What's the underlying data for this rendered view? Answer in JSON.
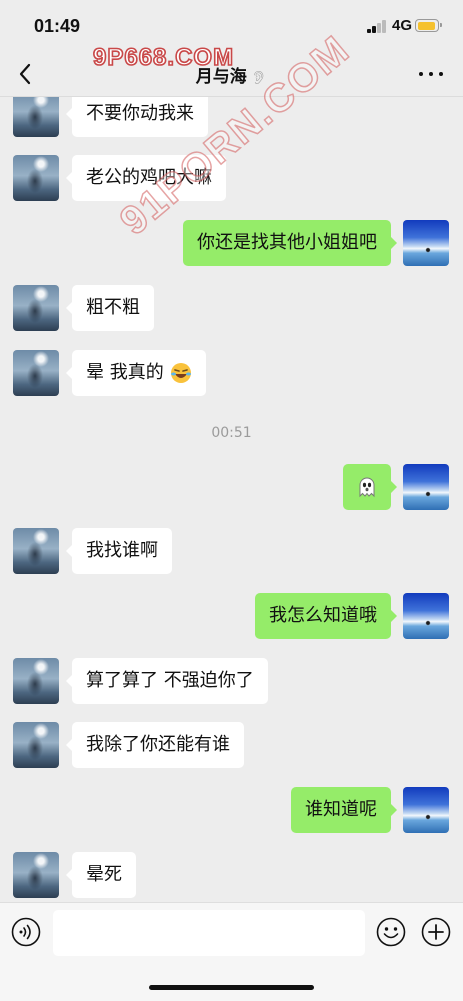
{
  "status_bar": {
    "time": "01:49",
    "network": "4G"
  },
  "header": {
    "title": "月与海"
  },
  "watermarks": {
    "top": "9P668.COM",
    "diagonal": "91PORN.COM"
  },
  "messages": [
    {
      "side": "them",
      "text": "不要你动我来"
    },
    {
      "side": "them",
      "text": "老公的鸡吧大嘛"
    },
    {
      "side": "me",
      "text": "你还是找其他小姐姐吧"
    },
    {
      "side": "them",
      "text": "粗不粗"
    },
    {
      "side": "them",
      "text": "晕 我真的",
      "emoji": "laughing-crying-emoji"
    },
    {
      "side": "time",
      "text": "00:51"
    },
    {
      "side": "me",
      "text": "",
      "emoji": "ghost-emoji"
    },
    {
      "side": "them",
      "text": "我找谁啊"
    },
    {
      "side": "me",
      "text": "我怎么知道哦"
    },
    {
      "side": "them",
      "text": "算了算了 不强迫你了"
    },
    {
      "side": "them",
      "text": "我除了你还能有谁"
    },
    {
      "side": "me",
      "text": "谁知道呢"
    },
    {
      "side": "them",
      "text": "晕死"
    }
  ],
  "input_bar": {
    "value": "",
    "placeholder": ""
  },
  "colors": {
    "me_bubble": "#95ec69",
    "them_bubble": "#ffffff",
    "background": "#ededed"
  }
}
